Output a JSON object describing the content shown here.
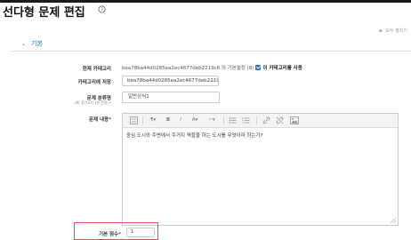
{
  "header": {
    "title": "선다형 문제 편집",
    "help_icon": "question-circle-icon"
  },
  "expand_all": {
    "label": "모두 펼치기",
    "icon": "triangle-right-icon"
  },
  "section": {
    "label": "기본",
    "icon": "chevron-down-icon"
  },
  "form": {
    "current_category": {
      "label": "현재 카테고리",
      "value": "bea78ba44d0285ea2ec4677deb2219c6 의 기본설정 (8)",
      "checkbox_checked": true,
      "use_label": "이 카테고리를 사용"
    },
    "save_category": {
      "label": "카테고리에 저장",
      "value": "bea78ba44d0285ea2ec4677deb2219c"
    },
    "question_name": {
      "label": "문제 분류명",
      "sublabel": "(예: 중간고사 1번 문항) *",
      "value": "일반상식1"
    },
    "question_text": {
      "label": "문제 내용",
      "required_mark": "*",
      "toolbar_icons": [
        "toolbar-toggle-icon",
        "paragraph-style-icon",
        "bold-icon",
        "italic-icon",
        "font-color-icon",
        "highlight-color-icon",
        "bullet-list-icon",
        "numbered-list-icon",
        "link-icon",
        "unlink-icon",
        "image-icon"
      ],
      "toolbar_labels": [
        "¶▾",
        "B",
        "I",
        "A▾",
        "⌐▾"
      ],
      "content": "중심 도시와 주변에서 주거지 역할을 하는 도시를 무엇이라 하는가?"
    },
    "default_mark": {
      "label": "기본 점수",
      "required_mark": "*",
      "value": "1"
    }
  },
  "colors": {
    "accent": "#2a72b5",
    "required": "#c62828",
    "highlight_border": "#d9534f"
  }
}
